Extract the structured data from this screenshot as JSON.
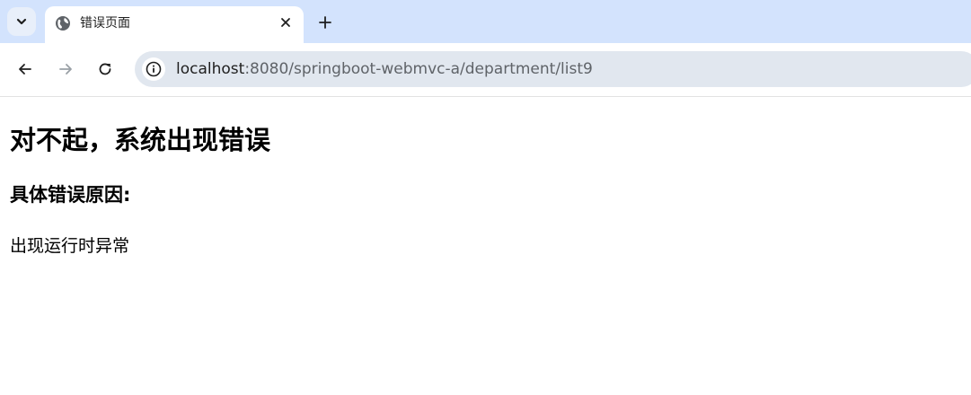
{
  "tab": {
    "title": "错误页面",
    "favicon": "globe-icon"
  },
  "address_bar": {
    "host": "localhost",
    "path": ":8080/springboot-webmvc-a/department/list9"
  },
  "page": {
    "heading": "对不起，系统出现错误",
    "subheading": "具体错误原因:",
    "message": "出现运行时异常"
  },
  "colors": {
    "tabstrip_bg": "#d3e3fd",
    "omnibox_bg": "#e1e7ef"
  }
}
